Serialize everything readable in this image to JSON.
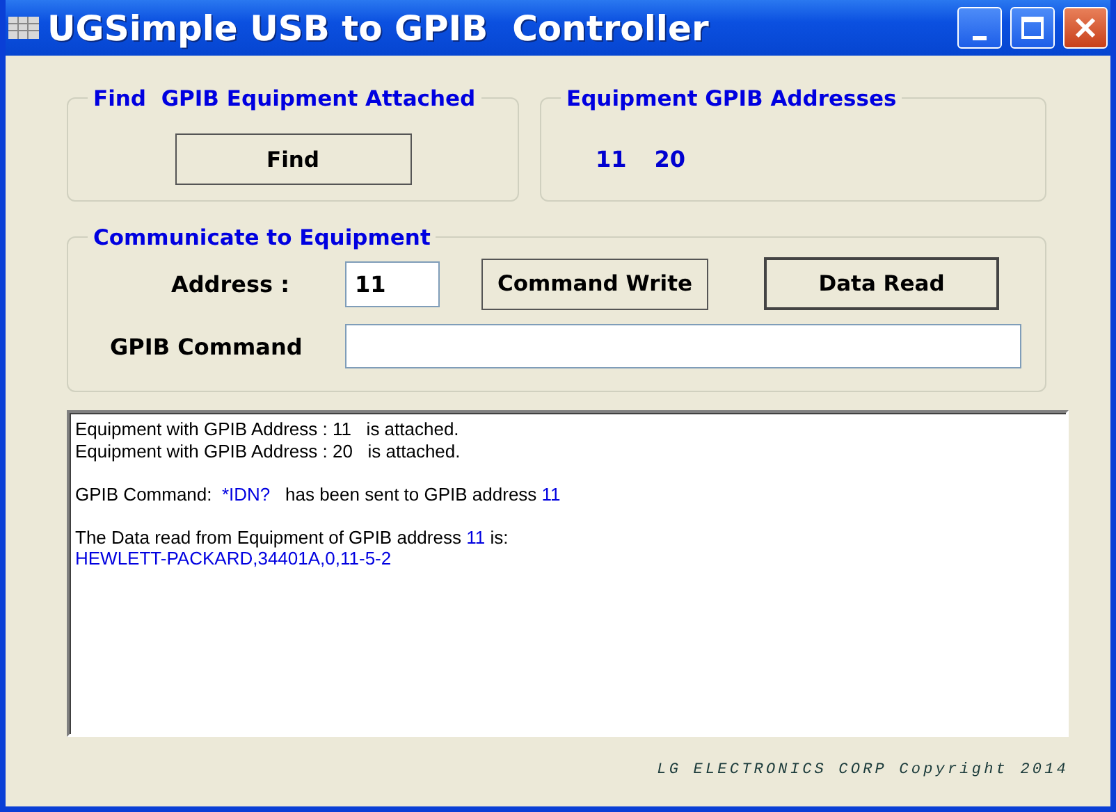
{
  "window": {
    "title": "UGSimple USB to GPIB  Controller"
  },
  "find_group": {
    "title": "Find  GPIB Equipment Attached",
    "button": "Find"
  },
  "addresses_group": {
    "title": "Equipment GPIB Addresses",
    "addresses": [
      "11",
      "20"
    ]
  },
  "communicate_group": {
    "title": "Communicate to Equipment",
    "address_label": "Address :",
    "address_value": "11",
    "command_write_button": "Command Write",
    "data_read_button": "Data Read",
    "command_label": "GPIB Command"
  },
  "log": [
    {
      "lines": [
        [
          {
            "text": "Equipment with GPIB Address : 11   is attached.",
            "highlight": false
          }
        ],
        [
          {
            "text": "Equipment with GPIB Address : 20   is attached.",
            "highlight": false
          }
        ]
      ]
    },
    {
      "lines": [
        [
          {
            "text": "GPIB Command:  ",
            "highlight": false
          },
          {
            "text": "*IDN?",
            "highlight": true
          },
          {
            "text": "   has been sent to GPIB address ",
            "highlight": false
          },
          {
            "text": "11",
            "highlight": true
          }
        ]
      ]
    },
    {
      "lines": [
        [
          {
            "text": "The Data read from Equipment of GPIB address ",
            "highlight": false
          },
          {
            "text": "11",
            "highlight": true
          },
          {
            "text": " is:",
            "highlight": false
          }
        ],
        [
          {
            "text": "HEWLETT-PACKARD,34401A,0,11-5-2",
            "highlight": true
          }
        ]
      ]
    }
  ],
  "footer": "LG ELECTRONICS CORP Copyright 2014"
}
